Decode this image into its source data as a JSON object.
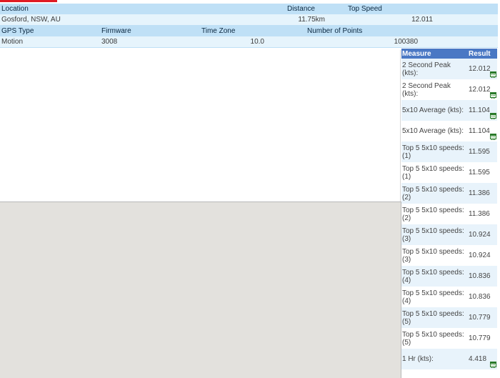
{
  "summary": {
    "headers1": [
      "Location",
      "Distance",
      "Top Speed"
    ],
    "values1": [
      "Gosford, NSW, AU",
      "11.75km",
      "12.011"
    ],
    "headers2": [
      "GPS Type",
      "Firmware",
      "Time Zone",
      "Number of Points"
    ],
    "values2": [
      "Motion",
      "3008",
      "10.0",
      "100380"
    ]
  },
  "measures": {
    "col_measure": "Measure",
    "col_result": "Result",
    "rows": [
      {
        "label": "2 Second Peak (kts):",
        "value": "12.012",
        "icon": "calendar-icon"
      },
      {
        "label": "2 Second Peak (kts):",
        "value": "12.012",
        "icon": "calendar-icon"
      },
      {
        "label": "5x10 Average (kts):",
        "value": "11.104",
        "icon": "calendar-icon"
      },
      {
        "label": "5x10 Average (kts):",
        "value": "11.104",
        "icon": "calendar-icon"
      },
      {
        "label": "Top 5 5x10 speeds: (1)",
        "value": "11.595",
        "icon": ""
      },
      {
        "label": "Top 5 5x10 speeds: (1)",
        "value": "11.595",
        "icon": ""
      },
      {
        "label": "Top 5 5x10 speeds: (2)",
        "value": "11.386",
        "icon": ""
      },
      {
        "label": "Top 5 5x10 speeds: (2)",
        "value": "11.386",
        "icon": ""
      },
      {
        "label": "Top 5 5x10 speeds: (3)",
        "value": "10.924",
        "icon": ""
      },
      {
        "label": "Top 5 5x10 speeds: (3)",
        "value": "10.924",
        "icon": ""
      },
      {
        "label": "Top 5 5x10 speeds: (4)",
        "value": "10.836",
        "icon": ""
      },
      {
        "label": "Top 5 5x10 speeds: (4)",
        "value": "10.836",
        "icon": ""
      },
      {
        "label": "Top 5 5x10 speeds: (5)",
        "value": "10.779",
        "icon": ""
      },
      {
        "label": "Top 5 5x10 speeds: (5)",
        "value": "10.779",
        "icon": ""
      },
      {
        "label": "1 Hr (kts):",
        "value": "4.418",
        "icon": "calendar-icon"
      }
    ]
  },
  "colors": {
    "header_bg": "#bfe0f6",
    "value_bg": "#e6f4fc",
    "measure_header_bg": "#4a78c4",
    "map_bg": "#e3e1dd",
    "accent_red": "#e01b24"
  }
}
